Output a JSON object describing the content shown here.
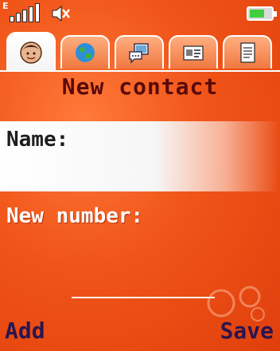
{
  "status_bar": {
    "network_letter": "E",
    "signal_icon": "signal-bars-icon",
    "signal_level": 4,
    "mute_icon": "speaker-muted-icon",
    "battery_icon": "battery-icon",
    "battery_level": 0.6
  },
  "tabs": [
    {
      "name": "tab-person",
      "icon": "person-icon"
    },
    {
      "name": "tab-globe",
      "icon": "globe-icon"
    },
    {
      "name": "tab-chat",
      "icon": "chat-icon"
    },
    {
      "name": "tab-address",
      "icon": "address-icon"
    },
    {
      "name": "tab-note",
      "icon": "note-icon"
    }
  ],
  "active_tab": 0,
  "screen": {
    "title": "New contact",
    "name_label": "Name:",
    "name_value": "",
    "number_label": "New number:",
    "number_value": ""
  },
  "softkeys": {
    "left": "Add",
    "right": "Save"
  },
  "colors": {
    "background": "#f05418",
    "title": "#5a0a0a",
    "softkey": "#2a1550",
    "battery_fill": "#3fcf3f"
  }
}
